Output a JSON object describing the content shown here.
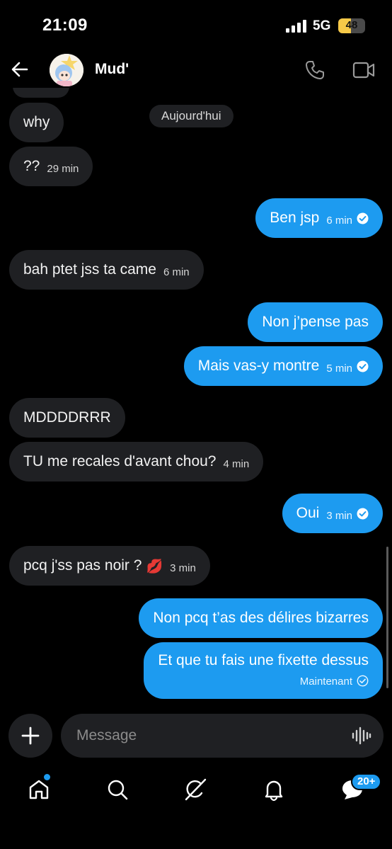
{
  "status_bar": {
    "time": "21:09",
    "network": "5G",
    "battery": "48",
    "battery_level": 0.48
  },
  "header": {
    "contact_name": "Mud'"
  },
  "chat": {
    "date_separator": "Aujourd'hui",
    "messages": [
      {
        "direction": "in",
        "text": "why",
        "time": ""
      },
      {
        "direction": "in",
        "text": "??",
        "time": "29 min"
      },
      {
        "direction": "out",
        "text": "Ben jsp",
        "time": "6 min",
        "read": true
      },
      {
        "direction": "in",
        "text": "bah ptet jss ta came",
        "time": "6 min"
      },
      {
        "direction": "out",
        "text": "Non j’pense pas",
        "time": ""
      },
      {
        "direction": "out",
        "text": "Mais vas-y montre",
        "time": "5 min",
        "read": true
      },
      {
        "direction": "in",
        "text": "MDDDDRRR",
        "time": ""
      },
      {
        "direction": "in",
        "text": "TU me recales d'avant chou?",
        "time": "4 min"
      },
      {
        "direction": "out",
        "text": "Oui",
        "time": "3 min",
        "read": true
      },
      {
        "direction": "in",
        "text": "pcq j'ss pas noir ?",
        "emoji": "💋",
        "time": "3 min"
      },
      {
        "direction": "out",
        "text": "Non pcq t’as des délires bizarres",
        "time": ""
      },
      {
        "direction": "out",
        "text": "Et que tu fais une fixette dessus",
        "time": "Maintenant",
        "read": true
      }
    ]
  },
  "composer": {
    "placeholder": "Message"
  },
  "nav": {
    "messages_badge": "20+"
  },
  "colors": {
    "accent": "#1d9bf0",
    "bubble_in": "#1f2023",
    "background": "#000000"
  },
  "icons": {
    "back": "back-arrow-icon",
    "call": "phone-icon",
    "video": "video-camera-icon",
    "add": "plus-icon",
    "voice": "voice-wave-icon",
    "home": "home-icon",
    "search": "search-icon",
    "grok": "grok-icon",
    "notifications": "bell-icon",
    "messages": "messages-icon",
    "read": "check-circle-icon"
  }
}
